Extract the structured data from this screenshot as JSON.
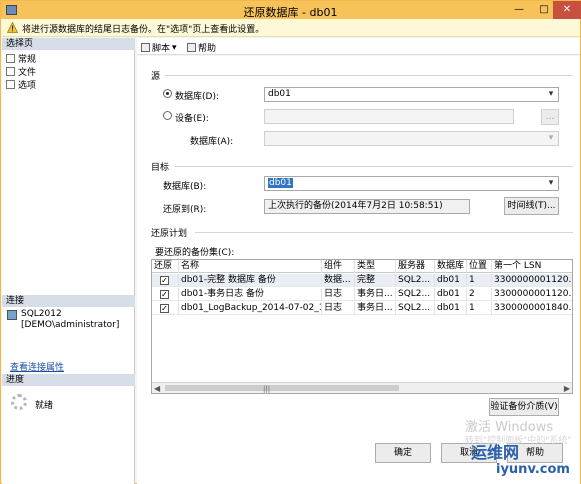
{
  "window": {
    "title": "还原数据库 - db01",
    "min": "—",
    "max": "□",
    "close": "✕"
  },
  "warning": {
    "text": "将进行源数据库的结尾日志备份。在\"选项\"页上查看此设置。"
  },
  "left": {
    "select_page_header": "选择页",
    "pages": [
      "常规",
      "文件",
      "选项"
    ],
    "connection_header": "连接",
    "connection_server": "SQL2012",
    "connection_user": "[DEMO\\administrator]",
    "connection_link": "查看连接属性",
    "progress_header": "进度",
    "progress_status": "就绪"
  },
  "toolbar": {
    "script": "脚本",
    "help": "帮助"
  },
  "source": {
    "section": "源",
    "database_radio": "数据库(D):",
    "database_value": "db01",
    "device_radio": "设备(E):",
    "device_value": "",
    "browse": "...",
    "device_db_label": "数据库(A):",
    "device_db_value": ""
  },
  "target": {
    "section": "目标",
    "database_label": "数据库(B):",
    "database_value": "db01",
    "restore_to_label": "还原到(R):",
    "restore_to_value": "上次执行的备份(2014年7月2日 10:58:51)",
    "timeline_button": "时间线(T)..."
  },
  "plan": {
    "section": "还原计划",
    "backupsets_label": "要还原的备份集(C):",
    "columns": [
      "还原",
      "名称",
      "组件",
      "类型",
      "服务器",
      "数据库",
      "位置",
      "第一个 LSN"
    ],
    "rows": [
      {
        "checked": true,
        "name": "db01-完整 数据库 备份",
        "component": "数据...",
        "type": "完整",
        "server": "SQL2...",
        "database": "db01",
        "position": "1",
        "lsn": "3300000001120..."
      },
      {
        "checked": true,
        "name": "db01-事务日志 备份",
        "component": "日志",
        "type": "事务日...",
        "server": "SQL2...",
        "database": "db01",
        "position": "2",
        "lsn": "3300000001120..."
      },
      {
        "checked": true,
        "name": "db01_LogBackup_2014-07-02_10...",
        "component": "日志",
        "type": "事务日...",
        "server": "SQL2...",
        "database": "db01",
        "position": "1",
        "lsn": "3300000001840..."
      }
    ],
    "verify_button": "验证备份介质(V)"
  },
  "buttons": {
    "ok": "确定",
    "cancel": "取消",
    "help": "帮助"
  },
  "watermark": {
    "activate": "激活 Windows",
    "sub": "转到\"控制面板\"中的\"系统\"",
    "logo": "运维网",
    "url": "iyunv.com"
  }
}
